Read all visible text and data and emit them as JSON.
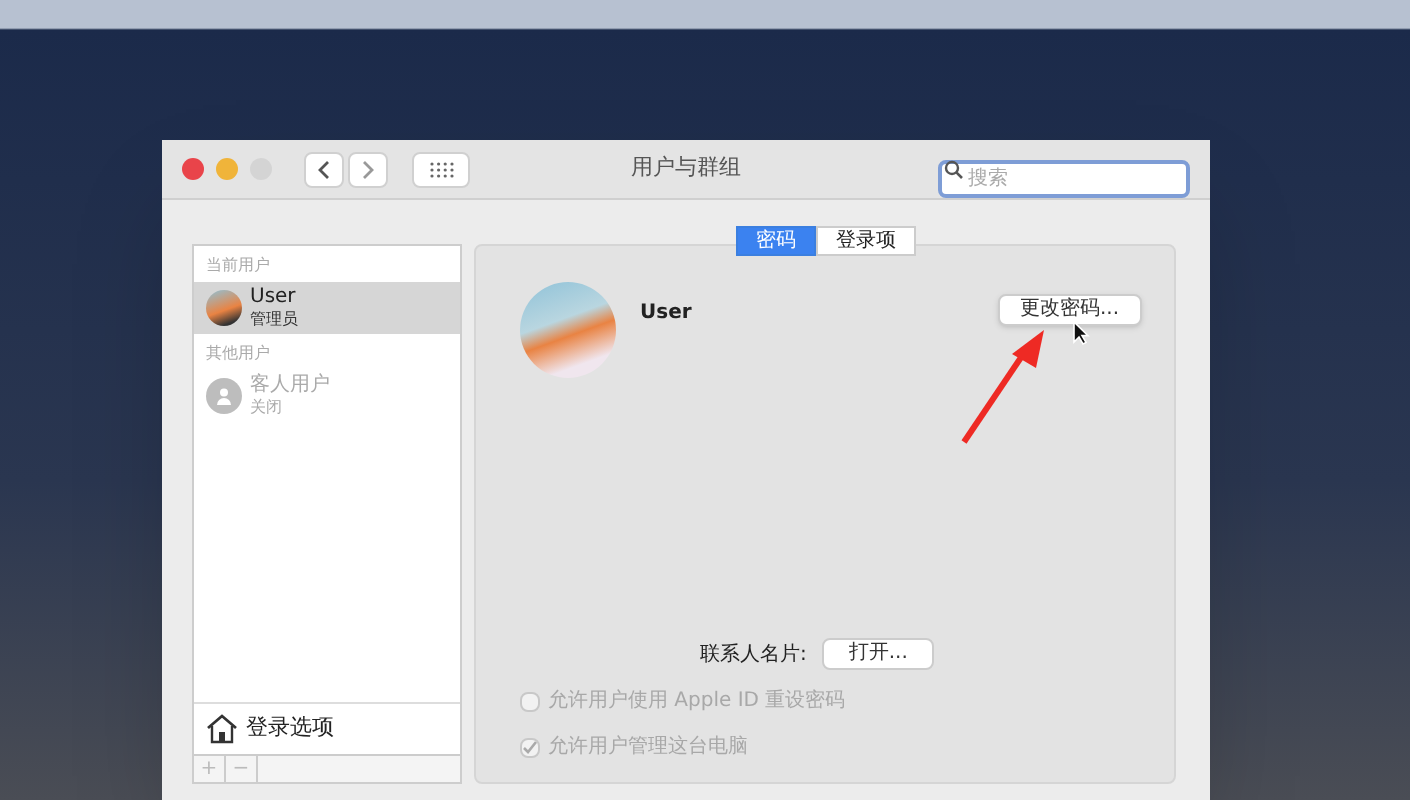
{
  "window": {
    "title": "用户与群组",
    "search": {
      "placeholder": "搜索"
    }
  },
  "tabs": [
    {
      "label": "密码",
      "selected": true
    },
    {
      "label": "登录项",
      "selected": false
    }
  ],
  "sidebar": {
    "sections": [
      {
        "header": "当前用户",
        "users": [
          {
            "name": "User",
            "role": "管理员",
            "selected": true,
            "kind": "photo"
          }
        ]
      },
      {
        "header": "其他用户",
        "users": [
          {
            "name": "客人用户",
            "role": "关闭",
            "selected": false,
            "kind": "generic"
          }
        ]
      }
    ],
    "login_options": "登录选项",
    "add": "+",
    "remove": "−"
  },
  "user": {
    "name": "User",
    "change_password": "更改密码..."
  },
  "contact_card": {
    "label": "联系人名片:",
    "button": "打开..."
  },
  "options": [
    {
      "label": "允许用户使用 Apple ID 重设密码",
      "checked": false,
      "disabled": true
    },
    {
      "label": "允许用户管理这台电脑",
      "checked": true,
      "disabled": true
    }
  ]
}
